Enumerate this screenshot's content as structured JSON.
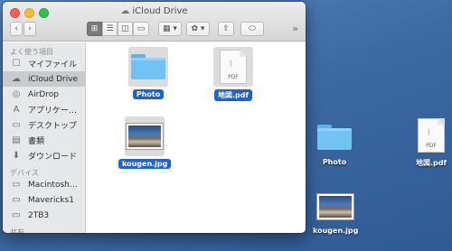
{
  "window": {
    "title": "iCloud Drive",
    "toolbar": {
      "back": "‹",
      "forward": "›",
      "view_icon": "⊞",
      "view_list": "☰",
      "view_columns": "◫",
      "view_coverflow": "▭",
      "arrange": "▦ ▾",
      "action": "✿ ▾",
      "share": "⇧",
      "tag": "⬭",
      "overflow": "»"
    }
  },
  "sidebar": {
    "favorites_header": "よく使う項目",
    "favorites": [
      {
        "label": "マイファイル",
        "icon": "☐"
      },
      {
        "label": "iCloud Drive",
        "icon": "☁",
        "selected": true
      },
      {
        "label": "AirDrop",
        "icon": "◎"
      },
      {
        "label": "アプリケー…",
        "icon": "A"
      },
      {
        "label": "デスクトップ",
        "icon": "▭"
      },
      {
        "label": "書類",
        "icon": "▤"
      },
      {
        "label": "ダウンロード",
        "icon": "⬇"
      }
    ],
    "devices_header": "デバイス",
    "devices": [
      {
        "label": "Macintosh…",
        "icon": "▭"
      },
      {
        "label": "Mavericks1",
        "icon": "▭"
      },
      {
        "label": "2TB3",
        "icon": "▭"
      }
    ],
    "shared_header": "共有"
  },
  "content": {
    "items": [
      {
        "label": "Photo",
        "kind": "folder"
      },
      {
        "label": "地図.pdf",
        "kind": "pdf",
        "badge": "PDF"
      },
      {
        "label": "kougen.jpg",
        "kind": "image"
      }
    ]
  },
  "desktop": {
    "items": [
      {
        "label": "Photo",
        "kind": "folder"
      },
      {
        "label": "地図.pdf",
        "kind": "pdf",
        "badge": "PDF"
      },
      {
        "label": "kougen.jpg",
        "kind": "image"
      }
    ]
  }
}
